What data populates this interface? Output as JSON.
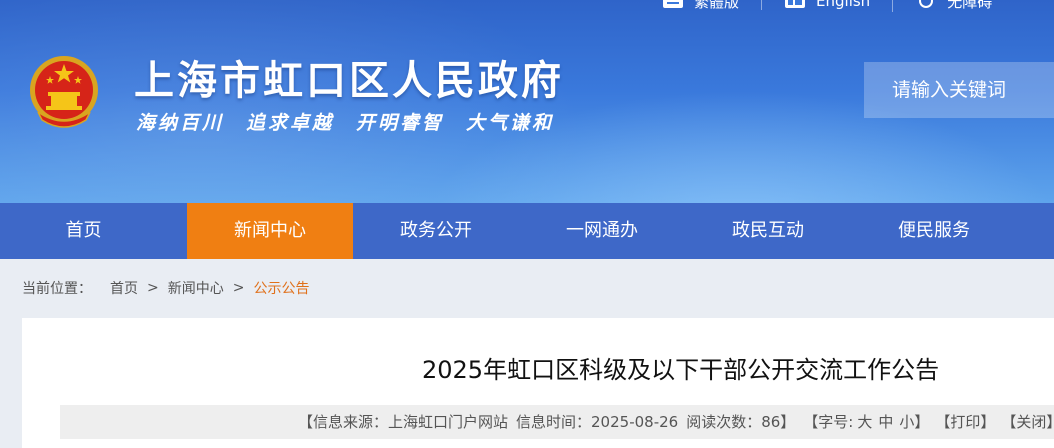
{
  "header": {
    "site_title": "上海市虹口区人民政府",
    "slogan": "海纳百川　追求卓越　开明睿智　大气谦和",
    "top_links": [
      {
        "label": "繁體版",
        "icon": "traditional-chinese-icon"
      },
      {
        "label": "English",
        "icon": "english-icon"
      },
      {
        "label": "无障碍",
        "icon": "accessibility-icon"
      }
    ],
    "search_placeholder": "请输入关键词"
  },
  "nav": {
    "items": [
      {
        "label": "首页"
      },
      {
        "label": "新闻中心",
        "active": true
      },
      {
        "label": "政务公开"
      },
      {
        "label": "一网通办"
      },
      {
        "label": "政民互动"
      },
      {
        "label": "便民服务"
      }
    ]
  },
  "breadcrumb": {
    "prefix": "当前位置：",
    "items": [
      "首页",
      "新闻中心"
    ],
    "separator": ">",
    "current": "公示公告"
  },
  "article": {
    "title": "2025年虹口区科级及以下干部公开交流工作公告",
    "source": "【信息来源：上海虹口门户网站",
    "time": "信息时间：2025-08-26",
    "reads": "阅读次数：86】",
    "font_size_label": "【字号:",
    "font_large": "大",
    "font_medium": "中",
    "font_small": "小】",
    "print": "【打印】",
    "close": "【关闭】"
  },
  "colors": {
    "nav_bg": "#3e68c8",
    "nav_active": "#f07f12",
    "breadcrumb_current": "#e0701a"
  }
}
